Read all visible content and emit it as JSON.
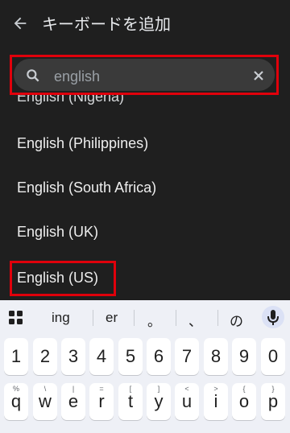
{
  "appbar": {
    "title": "キーボードを追加"
  },
  "search": {
    "value": "english"
  },
  "list": {
    "cut_item": "English (Nigeria)",
    "items": [
      {
        "label": "English (Philippines)"
      },
      {
        "label": "English (South Africa)"
      },
      {
        "label": "English (UK)"
      },
      {
        "label": "English (US)"
      }
    ]
  },
  "keyboard": {
    "suggestions": [
      "ing",
      "er",
      "。",
      "、",
      "の"
    ],
    "number_row": [
      "1",
      "2",
      "3",
      "4",
      "5",
      "6",
      "7",
      "8",
      "9",
      "0"
    ],
    "qwerty_row": [
      "q",
      "w",
      "e",
      "r",
      "t",
      "y",
      "u",
      "i",
      "o",
      "p"
    ],
    "qwerty_hints": [
      "%",
      "\\",
      "|",
      "=",
      "[",
      "]",
      "<",
      ">",
      "{",
      "}"
    ]
  },
  "colors": {
    "highlight": "#e0000b",
    "background": "#1f1f1f"
  }
}
